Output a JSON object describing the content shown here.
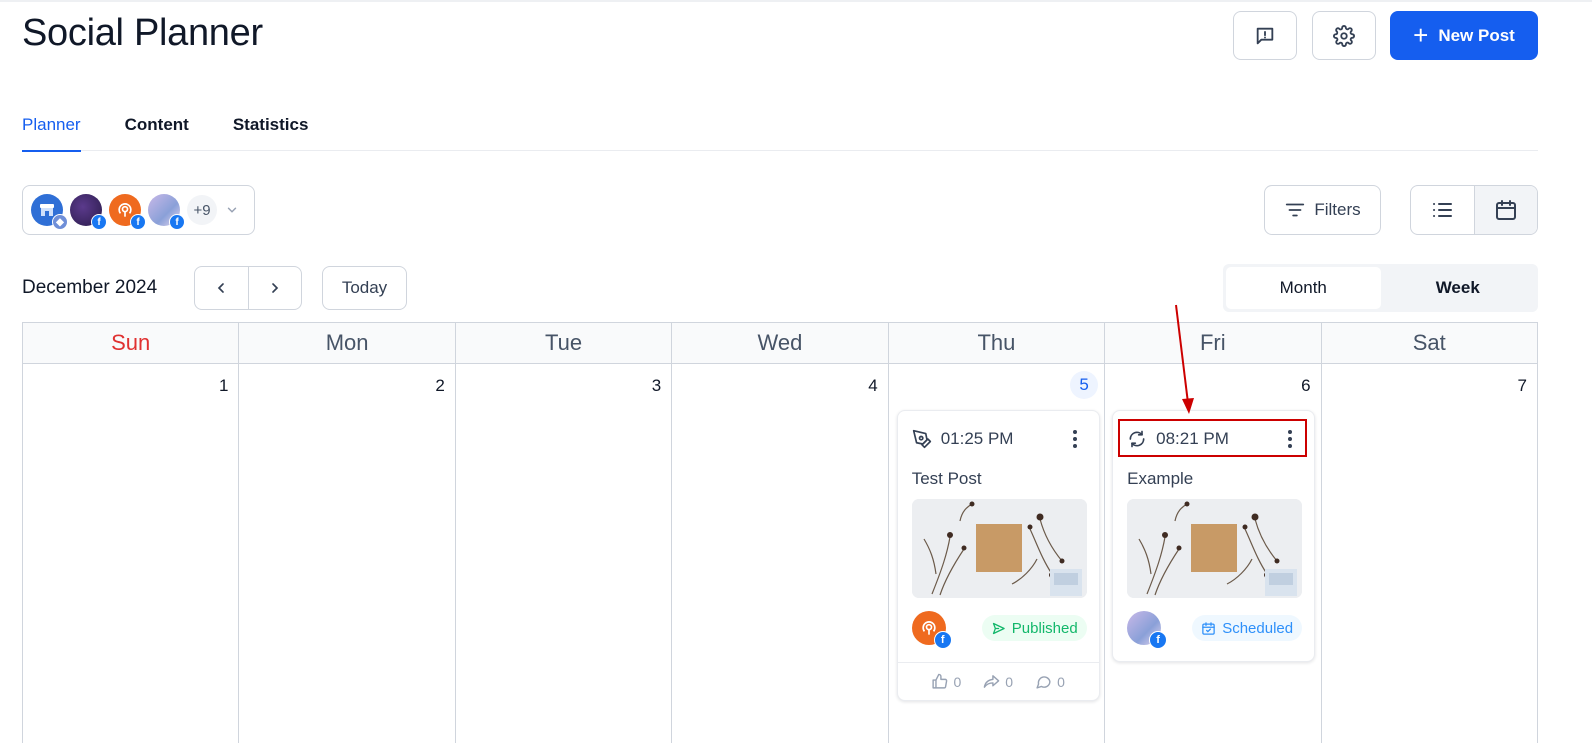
{
  "header": {
    "title": "Social Planner",
    "new_post_label": "New Post"
  },
  "tabs": [
    {
      "label": "Planner",
      "active": true
    },
    {
      "label": "Content",
      "active": false
    },
    {
      "label": "Statistics",
      "active": false
    }
  ],
  "accounts": {
    "more_count": "+9"
  },
  "toolbar": {
    "filters_label": "Filters"
  },
  "calendar": {
    "month_label": "December 2024",
    "today_label": "Today",
    "range_options": [
      "Month",
      "Week"
    ],
    "selected_range": "Month",
    "weekdays": [
      "Sun",
      "Mon",
      "Tue",
      "Wed",
      "Thu",
      "Fri",
      "Sat"
    ],
    "days": [
      "1",
      "2",
      "3",
      "4",
      "5",
      "6",
      "7"
    ],
    "today": "5"
  },
  "posts": [
    {
      "day": "5",
      "time": "01:25 PM",
      "title": "Test Post",
      "status": "Published",
      "likes": "0",
      "shares": "0",
      "comments": "0"
    },
    {
      "day": "6",
      "time": "08:21 PM",
      "title": "Example",
      "status": "Scheduled"
    }
  ],
  "colors": {
    "accent": "#155eef",
    "sunday": "#e03131",
    "published": "#12b76a",
    "scheduled": "#2e90fa",
    "annotation": "#cc0000",
    "facebook": "#1877f2"
  },
  "icons": {
    "feedback": "message-alert-icon",
    "settings": "gear-icon",
    "list_view": "list-icon",
    "calendar_view": "calendar-icon",
    "filters": "filter-lines-icon"
  }
}
